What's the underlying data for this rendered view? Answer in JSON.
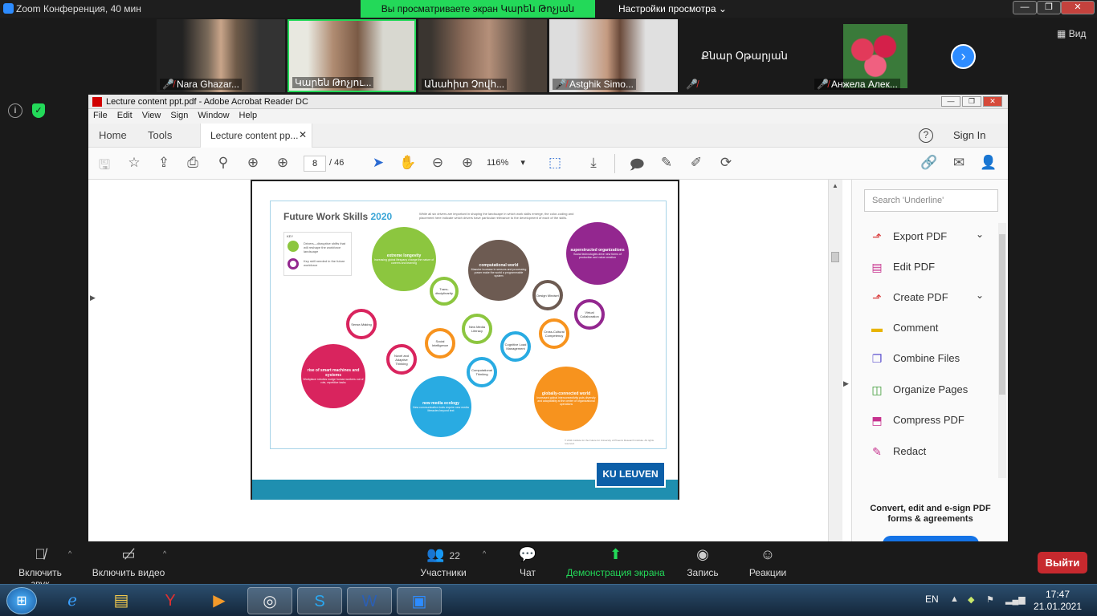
{
  "zoom": {
    "window_title": "Zoom Конференция, 40 мин",
    "share_banner": "Вы просматриваете экран Կարեն Թոչյան",
    "view_settings": "Настройки просмотра",
    "view_button": "Вид",
    "participants": [
      {
        "name": "Nara Ghazar...",
        "muted": true
      },
      {
        "name": "Կարեն Թոչյու...",
        "muted": false,
        "active": true
      },
      {
        "name": "Անահիտ Չովհ...",
        "muted": false
      },
      {
        "name": "Astghik Simo...",
        "muted": true
      },
      {
        "name": "Քնար Օթարյան",
        "muted": true,
        "no_video": true
      },
      {
        "name": "Анжела Алек...",
        "muted": true
      }
    ],
    "controls": {
      "audio": "Включить звук",
      "video": "Включить видео",
      "participants_label": "Участники",
      "participants_count": "22",
      "chat": "Чат",
      "share": "Демонстрация экрана",
      "record": "Запись",
      "reactions": "Реакции",
      "leave": "Выйти"
    },
    "colors": {
      "share_green": "#23d959",
      "leave_red": "#c7292e",
      "accent_blue": "#2d8cff"
    }
  },
  "acrobat": {
    "title": "Lecture content ppt.pdf - Adobe Acrobat Reader DC",
    "menu": [
      "File",
      "Edit",
      "View",
      "Sign",
      "Window",
      "Help"
    ],
    "tabs": {
      "home": "Home",
      "tools": "Tools",
      "doc_tab": "Lecture content pp..."
    },
    "sign_in": "Sign In",
    "page_current": "8",
    "page_total": "/ 46",
    "zoom_level": "116%",
    "search_placeholder": "Search 'Underline'",
    "tools": [
      {
        "label": "Export PDF",
        "icon": "export-pdf-icon",
        "color": "#d93a3a",
        "chevron": true
      },
      {
        "label": "Edit PDF",
        "icon": "edit-pdf-icon",
        "color": "#c6328e",
        "chevron": false
      },
      {
        "label": "Create PDF",
        "icon": "create-pdf-icon",
        "color": "#d93a3a",
        "chevron": true
      },
      {
        "label": "Comment",
        "icon": "comment-icon",
        "color": "#e8b400",
        "chevron": false
      },
      {
        "label": "Combine Files",
        "icon": "combine-files-icon",
        "color": "#5b4fcf",
        "chevron": false
      },
      {
        "label": "Organize Pages",
        "icon": "organize-pages-icon",
        "color": "#3d9a35",
        "chevron": false
      },
      {
        "label": "Compress PDF",
        "icon": "compress-pdf-icon",
        "color": "#c6328e",
        "chevron": false
      },
      {
        "label": "Redact",
        "icon": "redact-icon",
        "color": "#c6328e",
        "chevron": false
      }
    ],
    "promo": "Convert, edit and e-sign PDF forms & agreements"
  },
  "slide": {
    "title_main": "Future Work Skills ",
    "title_year": "2020",
    "description": "While all six drivers are important in shaping the landscape in which work skills emerge, the color-coding and placement here indicate which drivers have particular relevance to the development of each of the skills.",
    "key_label": "KEY",
    "key_drivers": "Drivers—disruptive shifts that will reshape the workforce landscape",
    "key_skills": "Key skill needed in the future workforce",
    "drivers": [
      {
        "title": "extreme longevity",
        "text": "Increasing global lifespans change the nature of careers and learning",
        "color": "#8cc63f"
      },
      {
        "title": "computational world",
        "text": "Massive increase in sensors and processing power make the world a programmable system",
        "color": "#6d5b52"
      },
      {
        "title": "superstructed organizations",
        "text": "Social technologies drive new forms of production and value creation",
        "color": "#93278f"
      },
      {
        "title": "rise of smart machines and systems",
        "text": "Workplace robotics nudge human workers out of rote, repetitive tasks",
        "color": "#d9245e"
      },
      {
        "title": "new media ecology",
        "text": "New communication tools require new media literacies beyond text",
        "color": "#29abe2"
      },
      {
        "title": "globally-connected world",
        "text": "Increased global interconnectivity puts diversity and adaptability at the center of organizational operations",
        "color": "#f7931e"
      }
    ],
    "skills": [
      {
        "label": "Trans-disciplinarity",
        "color": "#8cc63f"
      },
      {
        "label": "Design Mindset",
        "color": "#6d5b52"
      },
      {
        "label": "Virtual Collaboration",
        "color": "#93278f"
      },
      {
        "label": "Sense-Making",
        "color": "#d9245e"
      },
      {
        "label": "Social Intelligence",
        "color": "#f7931e"
      },
      {
        "label": "New Media Literacy",
        "color": "#8cc63f"
      },
      {
        "label": "Cognitive Load Management",
        "color": "#29abe2"
      },
      {
        "label": "Cross-Cultural Competency",
        "color": "#f7931e"
      },
      {
        "label": "Novel and Adaptive Thinking",
        "color": "#d9245e"
      },
      {
        "label": "Computational Thinking",
        "color": "#29abe2"
      }
    ],
    "footer_note": "© 2011 Institute for the Future for University of Phoenix Research Institute. All rights reserved.",
    "brand": "KU LEUVEN"
  },
  "taskbar": {
    "lang": "EN",
    "time": "17:47",
    "date": "21.01.2021"
  }
}
